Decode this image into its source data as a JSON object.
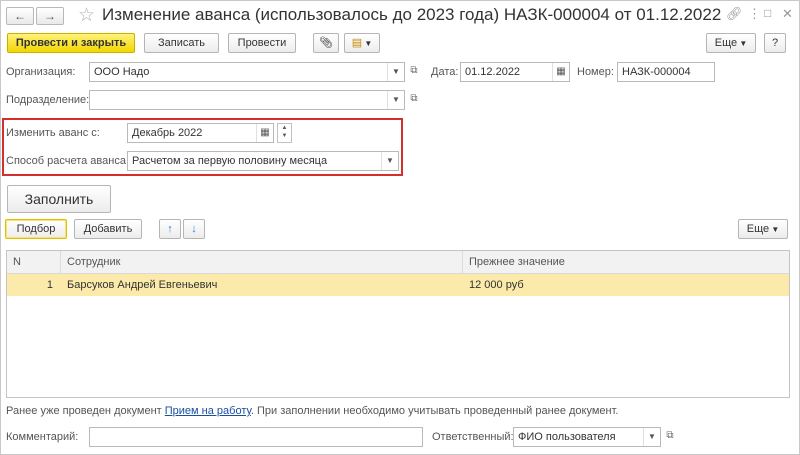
{
  "window": {
    "title": "Изменение аванса (использовалось до 2023 года) НАЗК-000004 от 01.12.2022"
  },
  "toolbar": {
    "post_close": "Провести и закрыть",
    "save": "Записать",
    "post": "Провести",
    "more": "Еще",
    "help": "?"
  },
  "form": {
    "org_label": "Организация:",
    "org_value": "ООО Надо",
    "date_label": "Дата:",
    "date_value": "01.12.2022",
    "number_label": "Номер:",
    "number_value": "НАЗК-000004",
    "dept_label": "Подразделение:",
    "dept_value": "",
    "change_label": "Изменить аванс с:",
    "change_value": "Декабрь 2022",
    "method_label": "Способ расчета аванса:",
    "method_value": "Расчетом за первую половину месяца"
  },
  "fill_button": "Заполнить",
  "table_toolbar": {
    "select": "Подбор",
    "add": "Добавить",
    "more": "Еще"
  },
  "table": {
    "columns": [
      "N",
      "Сотрудник",
      "Прежнее значение"
    ],
    "rows": [
      {
        "n": "1",
        "employee": "Барсуков Андрей Евгеньевич",
        "prev": "12 000 руб"
      }
    ]
  },
  "note": {
    "before": "Ранее уже проведен документ ",
    "link": "Прием на работу",
    "after": ". При заполнении необходимо учитывать проведенный ранее документ."
  },
  "footer": {
    "comment_label": "Комментарий:",
    "comment_value": "",
    "responsible_label": "Ответственный:",
    "responsible_value": "ФИО пользователя"
  },
  "colors": {
    "primary": "#f2d600",
    "highlight": "#d32f2f",
    "selected_row": "#fbeaaa",
    "link": "#1a4fa0"
  }
}
